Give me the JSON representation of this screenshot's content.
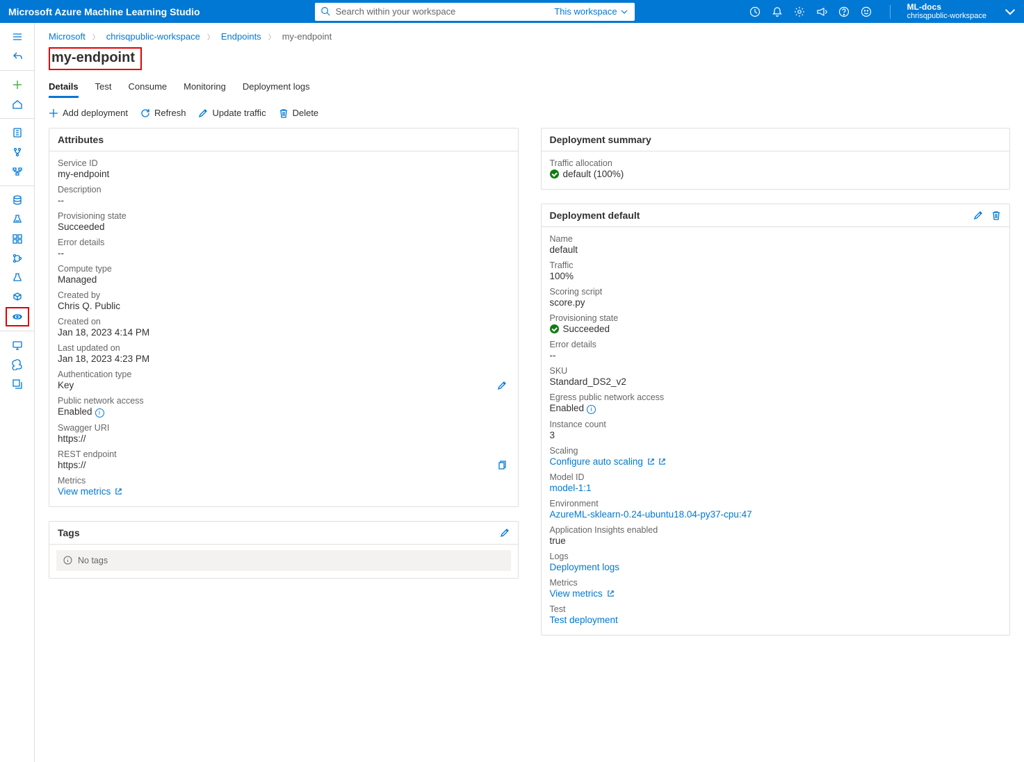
{
  "header": {
    "brand": "Microsoft Azure Machine Learning Studio",
    "search_placeholder": "Search within your workspace",
    "scope": "This workspace",
    "workspace": "ML-docs",
    "subscription": "chrisqpublic-workspace"
  },
  "breadcrumb": [
    "Microsoft",
    "chrisqpublic-workspace",
    "Endpoints",
    "my-endpoint"
  ],
  "page_title": "my-endpoint",
  "tabs": [
    "Details",
    "Test",
    "Consume",
    "Monitoring",
    "Deployment logs"
  ],
  "active_tab": "Details",
  "actions": {
    "add": "Add deployment",
    "refresh": "Refresh",
    "update": "Update traffic",
    "delete": "Delete"
  },
  "attributes": {
    "title": "Attributes",
    "service_id_lbl": "Service ID",
    "service_id": "my-endpoint",
    "description_lbl": "Description",
    "description": "--",
    "prov_lbl": "Provisioning state",
    "prov": "Succeeded",
    "err_lbl": "Error details",
    "err": "--",
    "compute_lbl": "Compute type",
    "compute": "Managed",
    "created_by_lbl": "Created by",
    "created_by": "Chris Q. Public",
    "created_on_lbl": "Created on",
    "created_on": "Jan 18, 2023 4:14 PM",
    "updated_lbl": "Last updated on",
    "updated": "Jan 18, 2023 4:23 PM",
    "auth_lbl": "Authentication type",
    "auth": "Key",
    "pub_lbl": "Public network access",
    "pub": "Enabled",
    "swagger_lbl": "Swagger URI",
    "swagger": "https://",
    "rest_lbl": "REST endpoint",
    "rest": "https://",
    "metrics_lbl": "Metrics",
    "metrics": "View metrics"
  },
  "tags": {
    "title": "Tags",
    "empty": "No tags"
  },
  "summary": {
    "title": "Deployment summary",
    "traffic_lbl": "Traffic allocation",
    "traffic": "default (100%)"
  },
  "deployment": {
    "title": "Deployment default",
    "name_lbl": "Name",
    "name": "default",
    "traffic_lbl": "Traffic",
    "traffic": "100%",
    "script_lbl": "Scoring script",
    "script": "score.py",
    "prov_lbl": "Provisioning state",
    "prov": "Succeeded",
    "err_lbl": "Error details",
    "err": "--",
    "sku_lbl": "SKU",
    "sku": "Standard_DS2_v2",
    "egress_lbl": "Egress public network access",
    "egress": "Enabled",
    "inst_lbl": "Instance count",
    "inst": "3",
    "scaling_lbl": "Scaling",
    "scaling": "Configure auto scaling",
    "model_lbl": "Model ID",
    "model": "model-1:1",
    "env_lbl": "Environment",
    "env": "AzureML-sklearn-0.24-ubuntu18.04-py37-cpu:47",
    "appins_lbl": "Application Insights enabled",
    "appins": "true",
    "logs_lbl": "Logs",
    "logs": "Deployment logs",
    "metrics_lbl": "Metrics",
    "metrics": "View metrics",
    "test_lbl": "Test",
    "test": "Test deployment"
  }
}
